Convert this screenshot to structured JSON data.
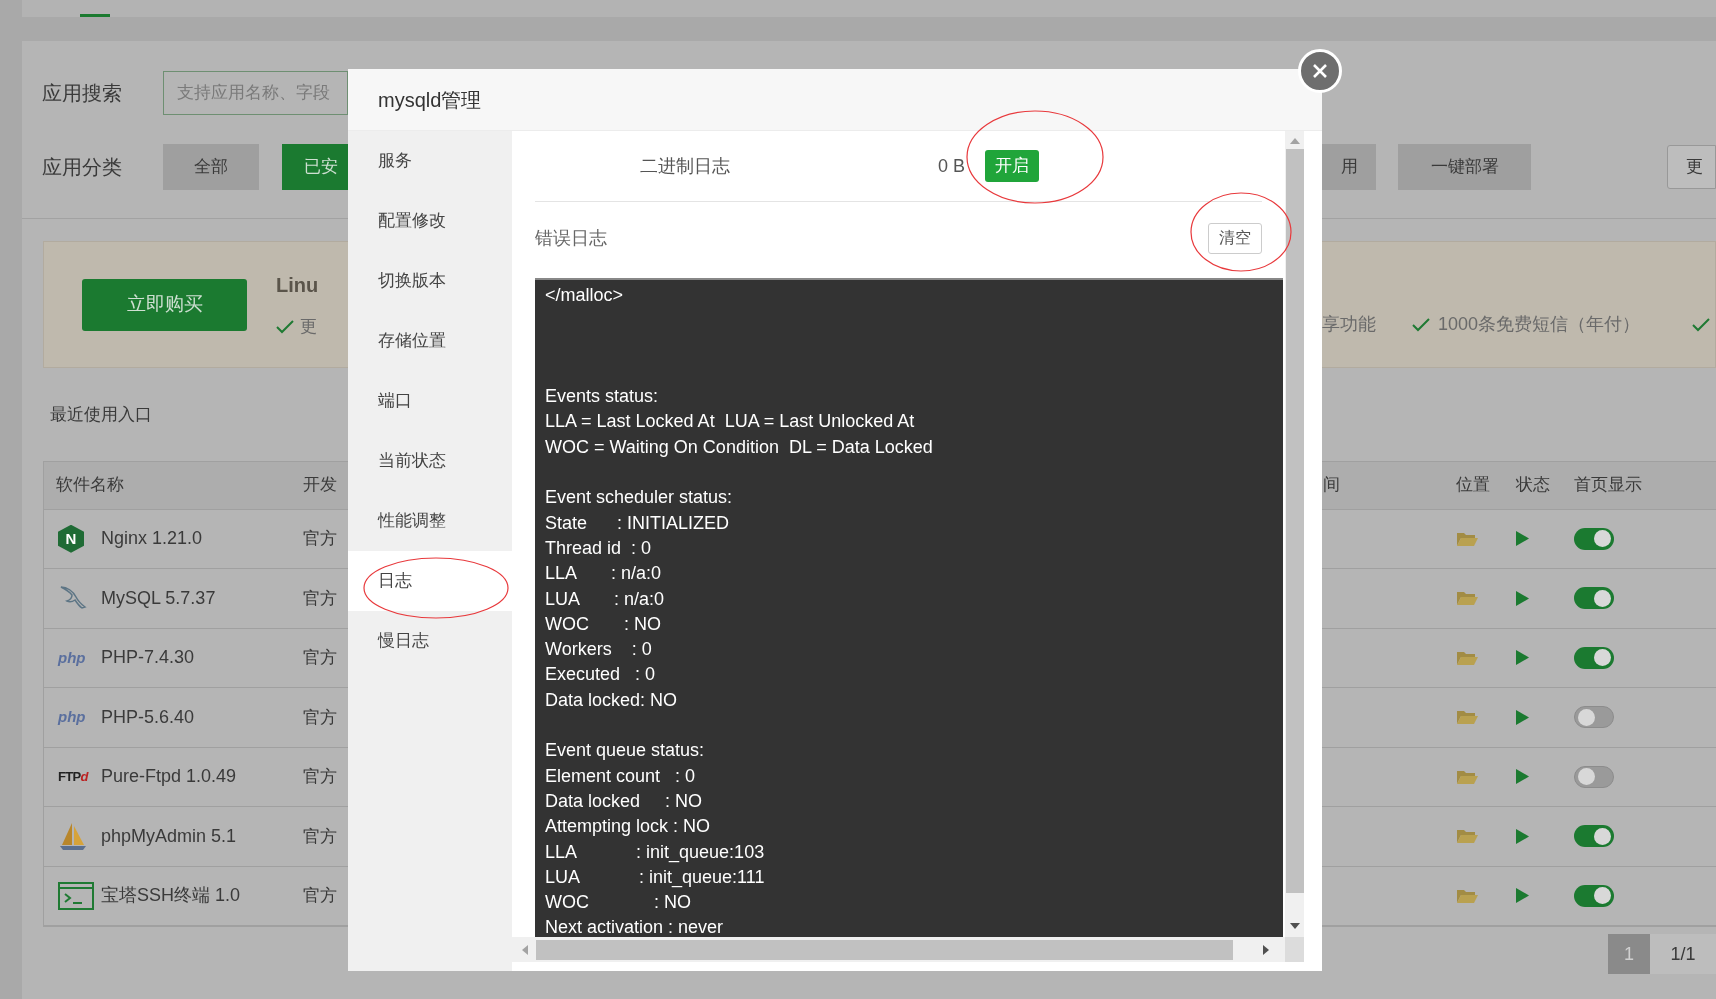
{
  "background": {
    "search": {
      "label": "应用搜索",
      "placeholder": "支持应用名称、字段"
    },
    "category": {
      "label": "应用分类",
      "left_buttons": [
        {
          "label": "全部",
          "selected": false
        },
        {
          "label": "已安",
          "selected": true
        }
      ],
      "right_buttons": [
        {
          "label": "用",
          "kind": "plain"
        },
        {
          "label": "一键部署",
          "kind": "plain"
        },
        {
          "label": "更",
          "kind": "outline"
        }
      ]
    },
    "promo": {
      "buy_button": "立即购买",
      "title": "Linu",
      "left_feature": "更",
      "right_text": "享功能",
      "right_feature": "1000条免费短信（年付）"
    },
    "recent_label": "最近使用入口",
    "table": {
      "columns_left": [
        "软件名称",
        "开发"
      ],
      "columns_right": [
        "间",
        "位置",
        "状态",
        "首页显示"
      ],
      "rows": [
        {
          "kind": "nginx",
          "logo_text": "N",
          "name": "Nginx 1.21.0",
          "vendor": "官方",
          "on": true
        },
        {
          "kind": "mysql",
          "name": "MySQL 5.7.37",
          "vendor": "官方",
          "on": true
        },
        {
          "kind": "php",
          "logo_text": "php",
          "name": "PHP-7.4.30",
          "vendor": "官方",
          "on": true
        },
        {
          "kind": "php",
          "logo_text": "php",
          "name": "PHP-5.6.40",
          "vendor": "官方",
          "on": false
        },
        {
          "kind": "ftp",
          "logo_text": "FTP",
          "logo_mark": "d",
          "name": "Pure-Ftpd 1.0.49",
          "vendor": "官方",
          "on": false
        },
        {
          "kind": "sailboat",
          "name": "phpMyAdmin 5.1",
          "vendor": "官方",
          "on": true
        },
        {
          "kind": "terminal",
          "name": "宝塔SSH终端 1.0",
          "vendor": "官方",
          "on": true
        }
      ]
    },
    "pagination": [
      {
        "label": "1",
        "selected": true
      },
      {
        "label": "1/1",
        "selected": false
      }
    ]
  },
  "modal": {
    "title": "mysqld管理",
    "menu": [
      {
        "label": "服务",
        "selected": false
      },
      {
        "label": "配置修改",
        "selected": false
      },
      {
        "label": "切换版本",
        "selected": false
      },
      {
        "label": "存储位置",
        "selected": false
      },
      {
        "label": "端口",
        "selected": false
      },
      {
        "label": "当前状态",
        "selected": false
      },
      {
        "label": "性能调整",
        "selected": false
      },
      {
        "label": "日志",
        "selected": true
      },
      {
        "label": "慢日志",
        "selected": false
      }
    ],
    "binary_log": {
      "label": "二进制日志",
      "size": "0 B",
      "button": "开启"
    },
    "error_log": {
      "label": "错误日志",
      "button": "清空"
    },
    "log_text": "</malloc>\n\n\n\nEvents status:\nLLA = Last Locked At  LUA = Last Unlocked At\nWOC = Waiting On Condition  DL = Data Locked\n\nEvent scheduler status:\nState      : INITIALIZED\nThread id  : 0\nLLA       : n/a:0\nLUA       : n/a:0\nWOC       : NO\nWorkers    : 0\nExecuted   : 0\nData locked: NO\n\nEvent queue status:\nElement count   : 0\nData locked     : NO\nAttempting lock : NO\nLLA            : init_queue:103\nLUA            : init_queue:111\nWOC             : NO\nNext activation : never"
  }
}
